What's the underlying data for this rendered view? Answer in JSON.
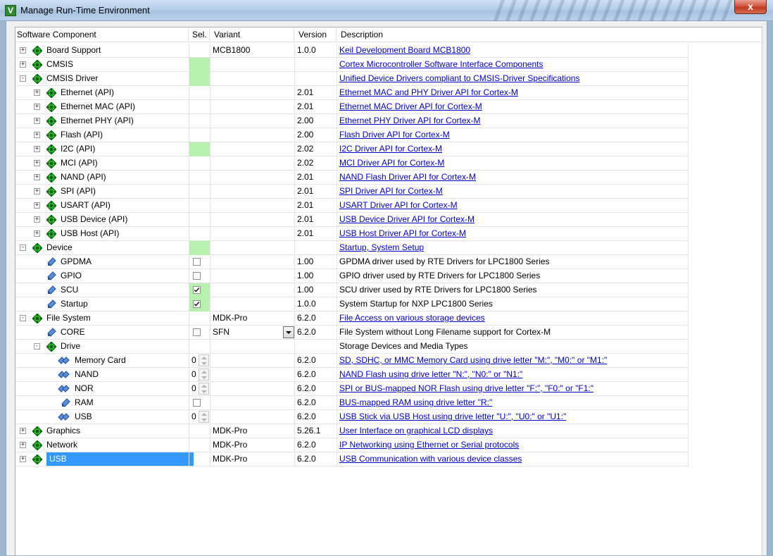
{
  "window": {
    "title": "Manage Run-Time Environment",
    "close_label": "x"
  },
  "columns": {
    "component": "Software Component",
    "sel": "Sel.",
    "variant": "Variant",
    "version": "Version",
    "description": "Description"
  },
  "rows": [
    {
      "name": "Board Support",
      "level": 0,
      "expander": "+",
      "icon": "gem",
      "sel": "",
      "variant": "MCB1800",
      "version": "1.0.0",
      "desc": "Keil Development Board MCB1800",
      "link": true
    },
    {
      "name": "CMSIS",
      "level": 0,
      "expander": "+",
      "icon": "gem",
      "sel": "green",
      "variant": "",
      "version": "",
      "desc": "Cortex Microcontroller Software Interface Components",
      "link": true
    },
    {
      "name": "CMSIS Driver",
      "level": 0,
      "expander": "-",
      "icon": "gem",
      "sel": "green",
      "variant": "",
      "version": "",
      "desc": "Unified Device Drivers compliant to CMSIS-Driver Specifications",
      "link": true
    },
    {
      "name": "Ethernet (API)",
      "level": 1,
      "expander": "+",
      "icon": "gem",
      "sel": "",
      "variant": "",
      "version": "2.01",
      "desc": "Ethernet MAC and PHY Driver API for Cortex-M",
      "link": true
    },
    {
      "name": "Ethernet MAC (API)",
      "level": 1,
      "expander": "+",
      "icon": "gem",
      "sel": "",
      "variant": "",
      "version": "2.01",
      "desc": "Ethernet MAC Driver API for Cortex-M",
      "link": true
    },
    {
      "name": "Ethernet PHY (API)",
      "level": 1,
      "expander": "+",
      "icon": "gem",
      "sel": "",
      "variant": "",
      "version": "2.00",
      "desc": "Ethernet PHY Driver API for Cortex-M",
      "link": true
    },
    {
      "name": "Flash (API)",
      "level": 1,
      "expander": "+",
      "icon": "gem",
      "sel": "",
      "variant": "",
      "version": "2.00",
      "desc": "Flash Driver API for Cortex-M",
      "link": true
    },
    {
      "name": "I2C (API)",
      "level": 1,
      "expander": "+",
      "icon": "gem",
      "sel": "green",
      "variant": "",
      "version": "2.02",
      "desc": "I2C Driver API for Cortex-M",
      "link": true
    },
    {
      "name": "MCI (API)",
      "level": 1,
      "expander": "+",
      "icon": "gem",
      "sel": "",
      "variant": "",
      "version": "2.02",
      "desc": "MCI Driver API for Cortex-M",
      "link": true
    },
    {
      "name": "NAND (API)",
      "level": 1,
      "expander": "+",
      "icon": "gem",
      "sel": "",
      "variant": "",
      "version": "2.01",
      "desc": "NAND Flash Driver API for Cortex-M",
      "link": true
    },
    {
      "name": "SPI (API)",
      "level": 1,
      "expander": "+",
      "icon": "gem",
      "sel": "",
      "variant": "",
      "version": "2.01",
      "desc": "SPI Driver API for Cortex-M",
      "link": true
    },
    {
      "name": "USART (API)",
      "level": 1,
      "expander": "+",
      "icon": "gem",
      "sel": "",
      "variant": "",
      "version": "2.01",
      "desc": "USART Driver API for Cortex-M",
      "link": true
    },
    {
      "name": "USB Device (API)",
      "level": 1,
      "expander": "+",
      "icon": "gem",
      "sel": "",
      "variant": "",
      "version": "2.01",
      "desc": "USB Device Driver API for Cortex-M",
      "link": true
    },
    {
      "name": "USB Host (API)",
      "level": 1,
      "expander": "+",
      "icon": "gem",
      "sel": "",
      "variant": "",
      "version": "2.01",
      "desc": "USB Host Driver API for Cortex-M",
      "link": true
    },
    {
      "name": "Device",
      "level": 0,
      "expander": "-",
      "icon": "gem",
      "sel": "green",
      "variant": "",
      "version": "",
      "desc": "Startup, System Setup",
      "link": true
    },
    {
      "name": "GPDMA",
      "level": 1,
      "expander": "",
      "icon": "leaf",
      "sel": "checkbox",
      "checked": false,
      "variant": "",
      "version": "1.00",
      "desc": "GPDMA driver used by RTE Drivers for LPC1800 Series",
      "link": false
    },
    {
      "name": "GPIO",
      "level": 1,
      "expander": "",
      "icon": "leaf",
      "sel": "checkbox",
      "checked": false,
      "variant": "",
      "version": "1.00",
      "desc": "GPIO driver used by RTE Drivers for LPC1800 Series",
      "link": false
    },
    {
      "name": "SCU",
      "level": 1,
      "expander": "",
      "icon": "leaf",
      "sel": "checkbox-green",
      "checked": true,
      "variant": "",
      "version": "1.00",
      "desc": "SCU driver used by RTE Drivers for LPC1800 Series",
      "link": false
    },
    {
      "name": "Startup",
      "level": 1,
      "expander": "",
      "icon": "leaf",
      "sel": "checkbox-green",
      "checked": true,
      "variant": "",
      "version": "1.0.0",
      "desc": "System Startup for NXP LPC1800 Series",
      "link": false
    },
    {
      "name": "File System",
      "level": 0,
      "expander": "-",
      "icon": "gem",
      "sel": "",
      "variant": "MDK-Pro",
      "version": "6.2.0",
      "desc": "File Access on various storage devices",
      "link": true
    },
    {
      "name": "CORE",
      "level": 1,
      "expander": "",
      "icon": "leaf",
      "sel": "checkbox",
      "checked": false,
      "variant": "SFN",
      "variant_dropdown": true,
      "version": "6.2.0",
      "desc": "File System without Long Filename support for Cortex-M",
      "link": false
    },
    {
      "name": "Drive",
      "level": 1,
      "expander": "-",
      "icon": "gem",
      "sel": "",
      "variant": "",
      "version": "",
      "desc": "Storage Devices and Media Types",
      "link": false
    },
    {
      "name": "Memory Card",
      "level": 2,
      "expander": "",
      "icon": "multi",
      "sel": "spin",
      "spin": "0",
      "variant": "",
      "version": "6.2.0",
      "desc": "SD, SDHC, or MMC Memory Card using drive letter \"M:\", \"M0:\" or \"M1:\"",
      "link": true
    },
    {
      "name": "NAND",
      "level": 2,
      "expander": "",
      "icon": "multi",
      "sel": "spin",
      "spin": "0",
      "variant": "",
      "version": "6.2.0",
      "desc": "NAND Flash using drive letter \"N:\", \"N0:\" or \"N1:\"",
      "link": true
    },
    {
      "name": "NOR",
      "level": 2,
      "expander": "",
      "icon": "multi",
      "sel": "spin",
      "spin": "0",
      "variant": "",
      "version": "6.2.0",
      "desc": "SPI or BUS-mapped NOR Flash using drive letter \"F:\", \"F0:\" or \"F1:\"",
      "link": true
    },
    {
      "name": "RAM",
      "level": 2,
      "expander": "",
      "icon": "leaf",
      "sel": "checkbox",
      "checked": false,
      "variant": "",
      "version": "6.2.0",
      "desc": "BUS-mapped RAM using drive letter \"R:\"",
      "link": true
    },
    {
      "name": "USB",
      "level": 2,
      "expander": "",
      "icon": "multi",
      "sel": "spin",
      "spin": "0",
      "variant": "",
      "version": "6.2.0",
      "desc": "USB Stick via USB Host using drive letter \"U:\", \"U0:\" or \"U1:\"",
      "link": true
    },
    {
      "name": "Graphics",
      "level": 0,
      "expander": "+",
      "icon": "gem",
      "sel": "",
      "variant": "MDK-Pro",
      "version": "5.26.1",
      "desc": "User Interface on graphical LCD displays",
      "link": true
    },
    {
      "name": "Network",
      "level": 0,
      "expander": "+",
      "icon": "gem",
      "sel": "",
      "variant": "MDK-Pro",
      "version": "6.2.0",
      "desc": "IP Networking using Ethernet or Serial protocols",
      "link": true
    },
    {
      "name": "USB",
      "level": 0,
      "expander": "+",
      "icon": "gem",
      "sel": "",
      "variant": "MDK-Pro",
      "version": "6.2.0",
      "desc": "USB Communication with various device classes",
      "link": true,
      "selected": true
    }
  ]
}
